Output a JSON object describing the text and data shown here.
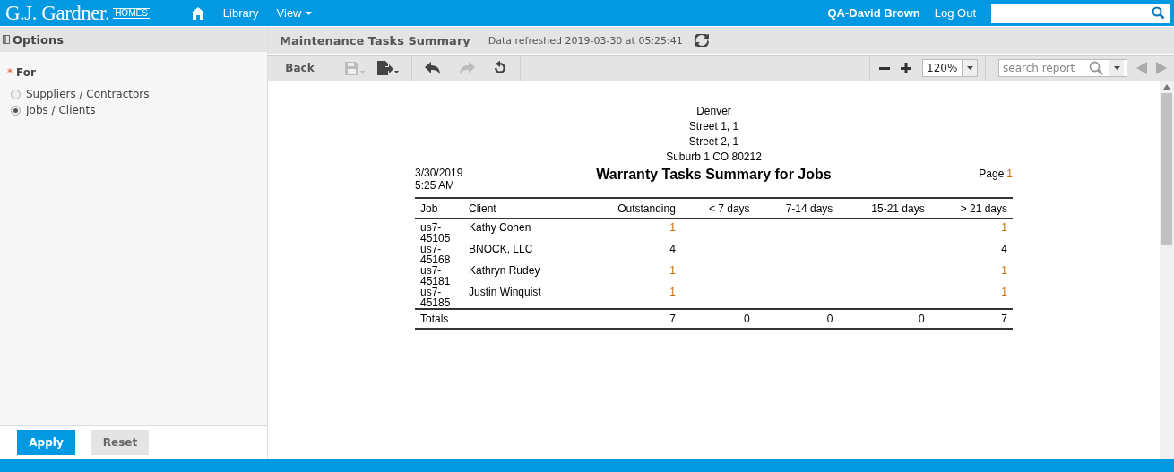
{
  "topbar": {
    "logo": "G.J. Gardner.",
    "logo_badge": "HOMES",
    "nav": [
      {
        "label": "Library",
        "kind": "link"
      },
      {
        "label": "View",
        "kind": "menu"
      }
    ],
    "user": "QA-David Brown",
    "logout": "Log Out"
  },
  "options": {
    "title": "Options",
    "field_label": "For",
    "required_mark": "*",
    "radios": [
      {
        "label": "Suppliers / Contractors",
        "selected": false
      },
      {
        "label": "Jobs / Clients",
        "selected": true
      }
    ],
    "apply": "Apply",
    "reset": "Reset"
  },
  "report_header": {
    "title": "Maintenance Tasks Summary",
    "refreshed": "Data refreshed 2019-03-30 at 05:25:41"
  },
  "toolbar": {
    "back": "Back",
    "zoom": "120%",
    "search_placeholder": "search report"
  },
  "report": {
    "address": [
      "Denver",
      "Street 1, 1",
      "Street 2, 1",
      "Suburb 1 CO 80212"
    ],
    "date": "3/30/2019",
    "time": "5:25 AM",
    "title": "Warranty Tasks Summary for Jobs",
    "page_label": "Page",
    "page_number": "1",
    "columns": [
      "Job",
      "Client",
      "Outstanding",
      "< 7 days",
      "7-14 days",
      "15-21 days",
      "> 21 days"
    ],
    "rows": [
      {
        "job": "us7-45105",
        "client": "Kathy Cohen",
        "outstanding": {
          "text": "1",
          "linked": true
        },
        "over_21_days": {
          "text": "1",
          "linked": true
        }
      },
      {
        "job": "us7-45168",
        "client": "BNOCK, LLC",
        "outstanding": {
          "text": "4",
          "linked": false
        },
        "over_21_days": {
          "text": "4",
          "linked": false
        }
      },
      {
        "job": "us7-45181",
        "client": "Kathryn Rudey",
        "outstanding": {
          "text": "1",
          "linked": true
        },
        "over_21_days": {
          "text": "1",
          "linked": true
        }
      },
      {
        "job": "us7-45185",
        "client": "Justin Winquist",
        "outstanding": {
          "text": "1",
          "linked": true
        },
        "over_21_days": {
          "text": "1",
          "linked": true
        }
      }
    ],
    "totals": {
      "label": "Totals",
      "values": [
        "7",
        "0",
        "0",
        "0",
        "7"
      ]
    }
  }
}
